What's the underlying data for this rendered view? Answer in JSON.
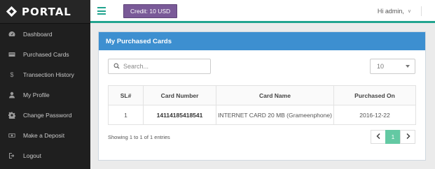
{
  "brand": {
    "name": "PORTAL",
    "logo_icon": "diamond-compass-icon"
  },
  "sidebar": {
    "items": [
      {
        "label": "Dashboard",
        "icon": "dashboard-icon"
      },
      {
        "label": "Purchased Cards",
        "icon": "card-icon"
      },
      {
        "label": "Transection History",
        "icon": "dollar-icon"
      },
      {
        "label": "My Profile",
        "icon": "user-icon"
      },
      {
        "label": "Change Password",
        "icon": "gear-icon"
      },
      {
        "label": "Make a Deposit",
        "icon": "cash-icon"
      },
      {
        "label": "Logout",
        "icon": "logout-icon"
      }
    ]
  },
  "topbar": {
    "credit_label": "Credit: 10 USD",
    "user_label": "Hi admin,",
    "caret": "∨"
  },
  "panel": {
    "title": "My Purchased Cards",
    "search_placeholder": "Search...",
    "page_size": "10",
    "columns": [
      "SL#",
      "Card Number",
      "Card Name",
      "Purchased On"
    ],
    "rows": [
      {
        "sl": "1",
        "card_number": "14114185418541",
        "card_name": "INTERNET CARD 20 MB (Grameenphone)",
        "purchased_on": "2016-12-22"
      }
    ],
    "info": "Showing 1 to 1 of 1 entries",
    "pagination": {
      "current": "1"
    }
  },
  "colors": {
    "accent": "#21a48f",
    "credit_bg": "#7a5a98",
    "panel_header": "#3d8fd0",
    "active_page": "#63c9a3",
    "sidebar_bg": "#1f1f1f"
  }
}
